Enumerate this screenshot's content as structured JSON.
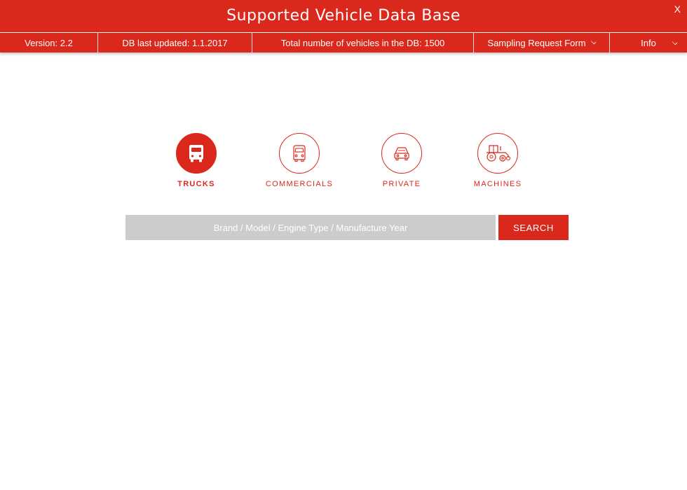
{
  "colors": {
    "accent": "#da291c",
    "search_field": "#cccccc",
    "background": "#ffffff"
  },
  "window": {
    "title": "Supported Vehicle Data Base",
    "close_label": "X"
  },
  "infobar": {
    "version": "Version: 2.2",
    "db_updated": "DB last updated: 1.1.2017",
    "total_vehicles": "Total number of vehicles in the DB: 1500",
    "sampling_form": "Sampling Request Form",
    "info": "Info"
  },
  "categories": [
    {
      "label": "TRUCKS",
      "icon": "truck-icon",
      "active": true
    },
    {
      "label": "COMMERCIALS",
      "icon": "van-icon",
      "active": false
    },
    {
      "label": "PRIVATE",
      "icon": "car-icon",
      "active": false
    },
    {
      "label": "MACHINES",
      "icon": "tractor-icon",
      "active": false
    }
  ],
  "search": {
    "placeholder": "Brand / Model / Engine Type / Manufacture Year",
    "value": "",
    "button_label": "SEARCH"
  }
}
